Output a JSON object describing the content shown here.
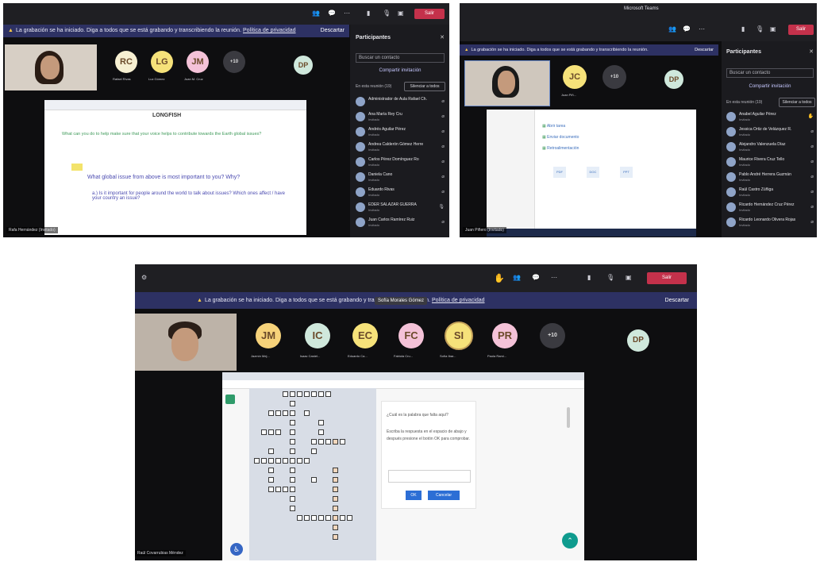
{
  "screens": [
    {
      "banner": {
        "text": "La grabación se ha iniciado. Diga a todos que se está grabando y transcribiendo la reunión.",
        "link": "Política de privacidad",
        "dismiss": "Descartar"
      },
      "toolbar": {
        "leave": "Salir",
        "timer": ""
      },
      "avatars": [
        {
          "initials": "RC",
          "name": "Rafael Rivas",
          "color": "#f7f0d2"
        },
        {
          "initials": "LG",
          "name": "Luz Gómez",
          "color": "#f6e27a"
        },
        {
          "initials": "JM",
          "name": "Juan M. Cruz",
          "color": "#f4c2d8"
        },
        {
          "initials": "+10",
          "name": "",
          "color": "#3a3a40"
        },
        {
          "initials": "DP",
          "name": "",
          "color": "#cfe8dc"
        }
      ],
      "participants": {
        "title": "Participantes",
        "search": "Buscar un contacto",
        "share": "Compartir invitación",
        "section": "En esta reunión (19)",
        "mute_all": "Silenciar a todos",
        "people": [
          {
            "name": "Administrador de Aula Rafael Ch.",
            "role": ""
          },
          {
            "name": "Ana María Rey Cru",
            "role": "Invitado"
          },
          {
            "name": "Andrés Aguilar Pérez",
            "role": "Invitado"
          },
          {
            "name": "Andrea Calderón Gómez Herre",
            "role": "Invitado"
          },
          {
            "name": "Carlos Pérez Domínguez Ro",
            "role": "Invitado"
          },
          {
            "name": "Daniela Cano",
            "role": "Invitado"
          },
          {
            "name": "Eduardo Rivas",
            "role": "Invitado"
          },
          {
            "name": "EDER SALAZAR GUERRA",
            "role": "Invitado"
          },
          {
            "name": "Juan Carlos Ramírez Ruiz",
            "role": "Invitado"
          }
        ]
      },
      "share": {
        "heading": "LONGFISH",
        "question1": "What can you do to help make sure that your voice helps to contribute towards the Earth global issues?",
        "question2": "What global issue from above is most important to you? Why?",
        "question3": "a.) Is it important for people around the world to talk about issues? Which ones affect / have your country an issue?"
      },
      "caption": "Rafa Hernández (Invitado)"
    },
    {
      "window_title": "Microsoft Teams",
      "banner": {
        "text": "La grabación se ha iniciado. Diga a todos que se está grabando y transcribiendo la reunión.",
        "link": "",
        "dismiss": "Descartar"
      },
      "toolbar": {
        "leave": "Salir"
      },
      "avatars": [
        {
          "initials": "JC",
          "name": "Juan Piñ...",
          "color": "#f6e27a"
        },
        {
          "initials": "+10",
          "name": "",
          "color": "#3a3a40"
        },
        {
          "initials": "DP",
          "name": "",
          "color": "#cfe8dc"
        }
      ],
      "participants": {
        "title": "Participantes",
        "search": "Buscar un contacto",
        "share": "Compartir invitación",
        "section": "En esta reunión (19)",
        "mute_all": "Silenciar a todos",
        "people": [
          {
            "name": "Anabel Aguilar Pérez",
            "role": "Invitado"
          },
          {
            "name": "Jessica Ortiz de Velázquez R.",
            "role": "Invitado"
          },
          {
            "name": "Alejandro Valenzuela Díaz",
            "role": "Invitado"
          },
          {
            "name": "Maurice Rivera Cruz Tello",
            "role": "Invitado"
          },
          {
            "name": "Pablo André Herrera Guzmán",
            "role": "Invitado"
          },
          {
            "name": "Raúl Castro Zúñiga",
            "role": "Invitado"
          },
          {
            "name": "Ricardo Hernández Cruz Pérez",
            "role": "Invitado"
          },
          {
            "name": "Ricardo Leonardo Olivera Rojas",
            "role": "Invitado"
          }
        ]
      },
      "share": {
        "heading": "Actividad de clase",
        "item1": "Abrir tarea",
        "item2": "Enviar documento",
        "item3": "Retroalimentación",
        "tiles": [
          "PDF",
          "DOC",
          "PPT"
        ]
      },
      "caption": "Juan Piñero (Invitado)"
    },
    {
      "banner": {
        "text": "La grabación se ha iniciado. Diga a todos que se está grabando y transcribiendo la reunión.",
        "link": "Política de privacidad",
        "dismiss": "Descartar",
        "tooltip": "Sofía Morales Gómez"
      },
      "toolbar": {
        "leave": "Salir"
      },
      "avatars": [
        {
          "initials": "JM",
          "name": "Jazmín Mej...",
          "color": "#f6d27a"
        },
        {
          "initials": "IC",
          "name": "Isaac Castel...",
          "color": "#cfe8dc"
        },
        {
          "initials": "EC",
          "name": "Eduardo Ca...",
          "color": "#f6e27a"
        },
        {
          "initials": "FC",
          "name": "Fabiola Cru...",
          "color": "#f4c2d8"
        },
        {
          "initials": "SI",
          "name": "Sofía Ibar...",
          "color": "#f6e27a"
        },
        {
          "initials": "PR",
          "name": "Paola Rami...",
          "color": "#f4c2d8"
        },
        {
          "initials": "+10",
          "name": "",
          "color": "#3a3a40"
        },
        {
          "initials": "DP",
          "name": "",
          "color": "#cfe8dc"
        }
      ],
      "dialog": {
        "line1": "¿Cuál es la palabra que falta aquí?",
        "line2": "Escriba la respuesta en el espacio de abajo y después presione el botón OK para comprobar.",
        "ok": "OK",
        "cancel": "Cancelar"
      },
      "caption": "Raúl Covarrubias Méndez"
    }
  ]
}
